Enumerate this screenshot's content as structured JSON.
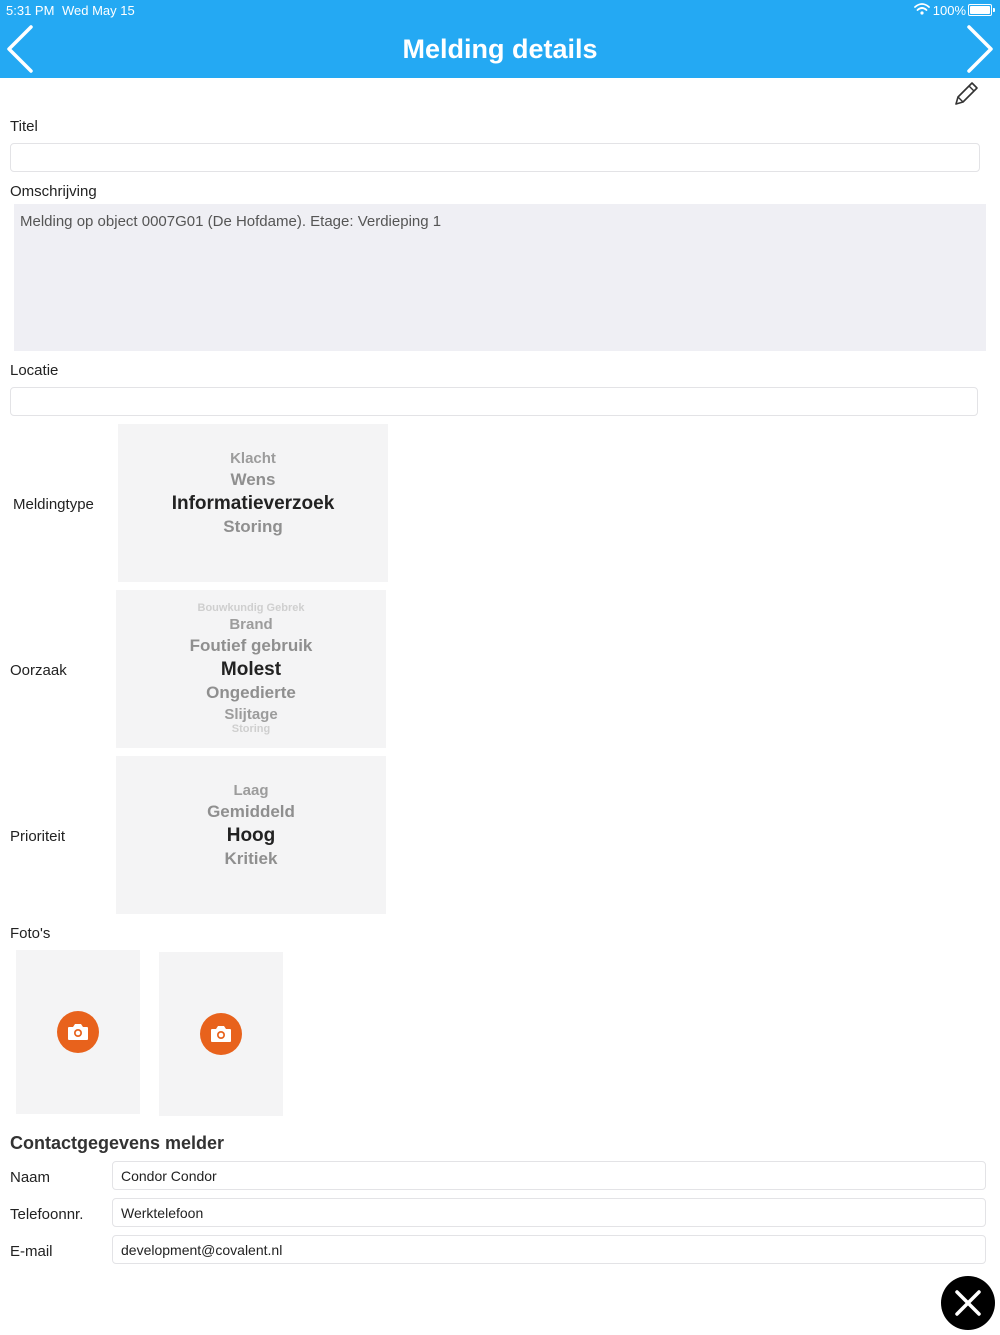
{
  "status": {
    "time": "5:31 PM",
    "date": "Wed May 15",
    "battery": "100%"
  },
  "header": {
    "title": "Melding details"
  },
  "icons": {
    "back": "chevron-left-icon",
    "forward": "chevron-right-icon",
    "edit": "pencil-icon",
    "camera": "camera-icon",
    "close": "close-icon",
    "wifi": "wifi-icon",
    "battery": "battery-icon"
  },
  "colors": {
    "header": "#24a9f3",
    "accent": "#e8621c",
    "field_bg": "#efeff4"
  },
  "form": {
    "titel": {
      "label": "Titel",
      "value": ""
    },
    "omschrijving": {
      "label": "Omschrijving",
      "value": "Melding op object 0007G01 (De Hofdame). Etage: Verdieping 1"
    },
    "locatie": {
      "label": "Locatie",
      "value": ""
    },
    "meldingtype": {
      "label": "Meldingtype",
      "options": [
        "Klacht",
        "Wens",
        "Informatieverzoek",
        "Storing"
      ],
      "selected": "Informatieverzoek"
    },
    "oorzaak": {
      "label": "Oorzaak",
      "options": [
        "Bouwkundig Gebrek",
        "Brand",
        "Foutief gebruik",
        "Molest",
        "Ongedierte",
        "Slijtage",
        "Storing"
      ],
      "selected": "Molest"
    },
    "prioriteit": {
      "label": "Prioriteit",
      "options": [
        "Laag",
        "Gemiddeld",
        "Hoog",
        "Kritiek"
      ],
      "selected": "Hoog"
    },
    "fotos": {
      "label": "Foto's"
    }
  },
  "contact": {
    "title": "Contactgegevens melder",
    "naam": {
      "label": "Naam",
      "value": "Condor  Condor"
    },
    "telefoon": {
      "label": "Telefoonnr.",
      "value": "Werktelefoon"
    },
    "email": {
      "label": "E-mail",
      "value": "development@covalent.nl"
    }
  }
}
